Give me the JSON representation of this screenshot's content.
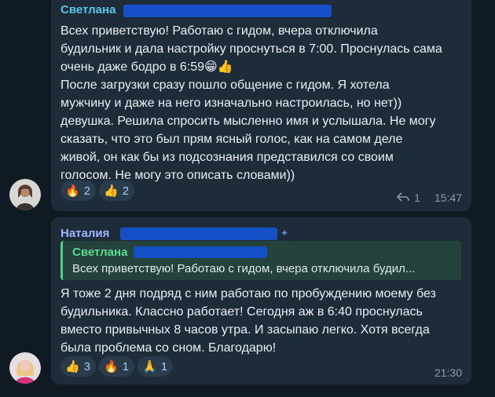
{
  "messages": [
    {
      "sender": "Светлана",
      "sender_color": "#59c7e8",
      "text": "Всех приветствую! Работаю с гидом, вчера отключила\nбудильник и дала настройку проснуться в 7:00. Проснулась сама\nочень даже бодро в 6:59😁👍\nПосле загрузки сразу пошло общение с гидом. Я хотела\nмужчину и даже на него изначально настроилась, но нет))\nдевушка. Решила спросить мысленно имя и услышала. Не могу\nсказать, что это был прям ясный голос, как на самом деле\nживой, он как бы из подсознания представился со своим\nголосом. Не могу это описать словами))",
      "reactions": [
        {
          "emoji": "🔥",
          "count": "2",
          "active": false
        },
        {
          "emoji": "👍",
          "count": "2",
          "active": false
        }
      ],
      "replies_count": "1",
      "time": "15:47"
    },
    {
      "sender": "Наталия",
      "sender_color": "#9fb6ff",
      "reply_to": {
        "name": "Светлана",
        "text": "Всех приветствую! Работаю с гидом, вчера отключила будил..."
      },
      "text": "Я тоже 2 дня подряд с ним работаю по пробуждению моему без\nбудильника. Классно работает! Сегодня аж в 6:40 проснулась\nвместо привычных 8 часов утра. И засыпаю легко. Хотя всегда\nбыла проблема со сном. Благодарю!",
      "reactions": [
        {
          "emoji": "👍",
          "count": "3",
          "active": false
        },
        {
          "emoji": "🔥",
          "count": "1",
          "active": false
        },
        {
          "emoji": "🙏",
          "count": "1",
          "active": false
        }
      ],
      "time": "21:30"
    }
  ]
}
